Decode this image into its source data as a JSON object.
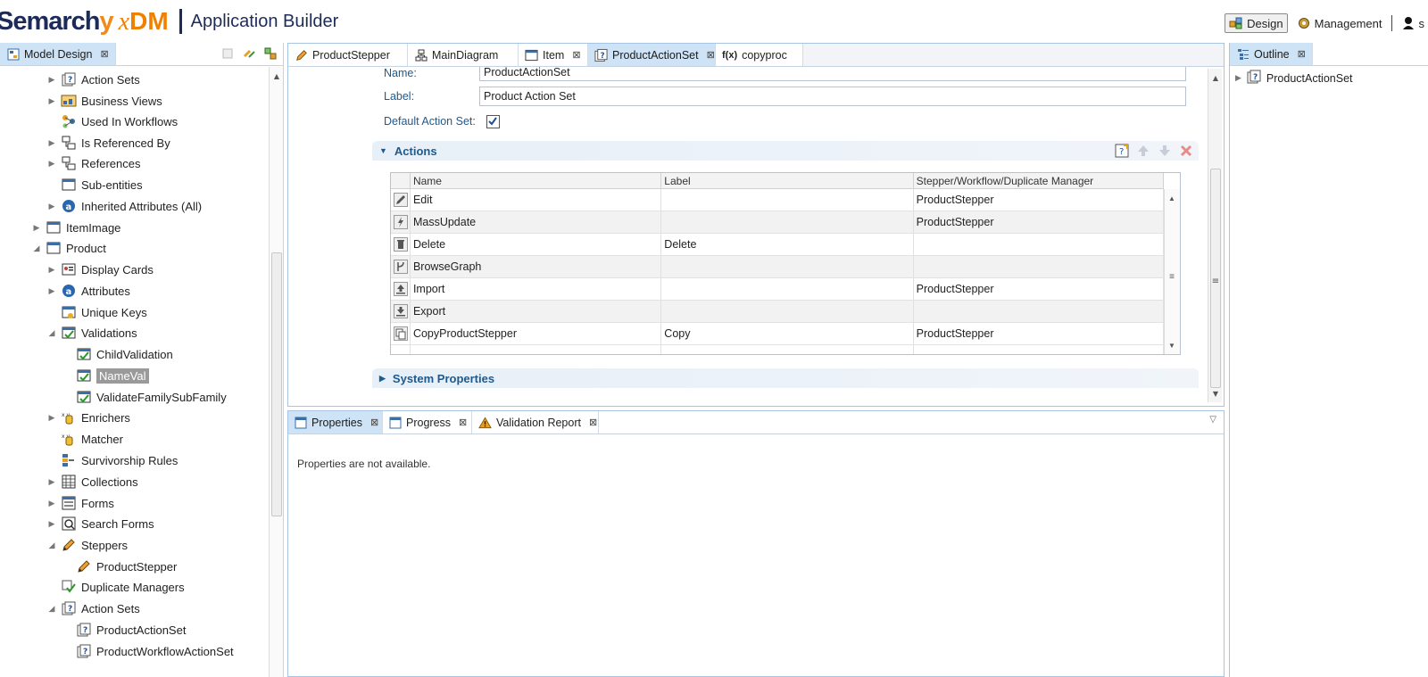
{
  "header": {
    "brand_name": "Semarch",
    "brand_y": "y",
    "brand_x": "x",
    "brand_dm": "DM",
    "app_title": "Application Builder",
    "perspectives": [
      {
        "label": "Design",
        "active": true
      },
      {
        "label": "Management",
        "active": false
      },
      {
        "label": "s",
        "active": false
      }
    ]
  },
  "model_panel": {
    "tab_label": "Model Design",
    "tree": [
      {
        "label": "Action Sets",
        "icon": "action-set-icon",
        "twisty": "collapsed"
      },
      {
        "label": "Business Views",
        "icon": "business-view-icon",
        "twisty": "collapsed"
      },
      {
        "label": "Used In Workflows",
        "icon": "workflow-icon",
        "twisty": "none"
      },
      {
        "label": "Is Referenced By",
        "icon": "reference-icon",
        "twisty": "collapsed"
      },
      {
        "label": "References",
        "icon": "reference-icon",
        "twisty": "collapsed"
      },
      {
        "label": "Sub-entities",
        "icon": "entity-icon",
        "twisty": "none"
      },
      {
        "label": "Inherited Attributes (All)",
        "icon": "attribute-icon",
        "twisty": "collapsed"
      },
      {
        "label": "ItemImage",
        "icon": "entity-icon",
        "twisty": "collapsed"
      },
      {
        "label": "Product",
        "icon": "entity-icon",
        "twisty": "expanded"
      },
      {
        "label": "Display Cards",
        "icon": "display-card-icon",
        "twisty": "collapsed"
      },
      {
        "label": "Attributes",
        "icon": "attribute-icon",
        "twisty": "collapsed"
      },
      {
        "label": "Unique Keys",
        "icon": "unique-key-icon",
        "twisty": "none"
      },
      {
        "label": "Validations",
        "icon": "validation-icon",
        "twisty": "expanded"
      },
      {
        "label": "ChildValidation",
        "icon": "validation-icon",
        "twisty": "none"
      },
      {
        "label": "NameVal",
        "icon": "validation-icon",
        "twisty": "none",
        "selected": true
      },
      {
        "label": "ValidateFamilySubFamily",
        "icon": "validation-icon",
        "twisty": "none"
      },
      {
        "label": "Enrichers",
        "icon": "enricher-icon",
        "twisty": "collapsed"
      },
      {
        "label": "Matcher",
        "icon": "matcher-icon",
        "twisty": "none"
      },
      {
        "label": "Survivorship Rules",
        "icon": "survivorship-icon",
        "twisty": "none"
      },
      {
        "label": "Collections",
        "icon": "collection-icon",
        "twisty": "collapsed"
      },
      {
        "label": "Forms",
        "icon": "form-icon",
        "twisty": "collapsed"
      },
      {
        "label": "Search Forms",
        "icon": "search-form-icon",
        "twisty": "collapsed"
      },
      {
        "label": "Steppers",
        "icon": "stepper-icon",
        "twisty": "expanded"
      },
      {
        "label": "ProductStepper",
        "icon": "stepper-icon",
        "twisty": "none"
      },
      {
        "label": "Duplicate Managers",
        "icon": "duplicate-manager-icon",
        "twisty": "none"
      },
      {
        "label": "Action Sets",
        "icon": "action-set-icon",
        "twisty": "expanded"
      },
      {
        "label": "ProductActionSet",
        "icon": "action-set-icon",
        "twisty": "none"
      },
      {
        "label": "ProductWorkflowActionSet",
        "icon": "action-set-icon",
        "twisty": "none"
      }
    ]
  },
  "editor": {
    "tabs": [
      {
        "label": "ProductStepper",
        "icon": "pencil-icon",
        "closable": false,
        "active": false
      },
      {
        "label": "MainDiagram",
        "icon": "diagram-icon",
        "closable": false,
        "active": false
      },
      {
        "label": "Item",
        "icon": "entity-icon",
        "closable": true,
        "active": false
      },
      {
        "label": "ProductActionSet",
        "icon": "action-set-icon",
        "closable": true,
        "active": true
      },
      {
        "label": "copyproc",
        "icon": "function-icon",
        "closable": false,
        "active": false
      }
    ],
    "function_prefix": "f(x)",
    "name_label": "Name:",
    "name_value": "ProductActionSet",
    "label_label": "Label:",
    "label_value": "Product Action Set",
    "default_label": "Default Action Set:",
    "default_checked": true,
    "actions_title": "Actions",
    "system_properties_title": "System Properties",
    "columns": [
      "Name",
      "Label",
      "Stepper/Workflow/Duplicate Manager"
    ],
    "rows": [
      {
        "name": "Edit",
        "label": "",
        "manager": "ProductStepper",
        "icon": "edit-icon"
      },
      {
        "name": "MassUpdate",
        "label": "",
        "manager": "ProductStepper",
        "icon": "mass-update-icon"
      },
      {
        "name": "Delete",
        "label": "Delete",
        "manager": "",
        "icon": "delete-icon"
      },
      {
        "name": "BrowseGraph",
        "label": "",
        "manager": "",
        "icon": "graph-icon"
      },
      {
        "name": "Import",
        "label": "",
        "manager": "ProductStepper",
        "icon": "import-icon"
      },
      {
        "name": "Export",
        "label": "",
        "manager": "",
        "icon": "export-icon"
      },
      {
        "name": "CopyProductStepper",
        "label": "Copy",
        "manager": "ProductStepper",
        "icon": "copy-icon"
      }
    ]
  },
  "props_panel": {
    "tabs": [
      {
        "label": "Properties",
        "icon": "properties-icon",
        "active": true
      },
      {
        "label": "Progress",
        "icon": "progress-icon",
        "active": false
      },
      {
        "label": "Validation Report",
        "icon": "warning-icon",
        "active": false
      }
    ],
    "message": "Properties are not available."
  },
  "outline_panel": {
    "tab_label": "Outline",
    "item_label": "ProductActionSet"
  },
  "close_glyph": "⊠",
  "colors": {
    "brand_navy": "#1d2b5b",
    "brand_orange": "#f08000",
    "active_tab": "#cfe3f7",
    "label_blue": "#1f5a8c"
  }
}
